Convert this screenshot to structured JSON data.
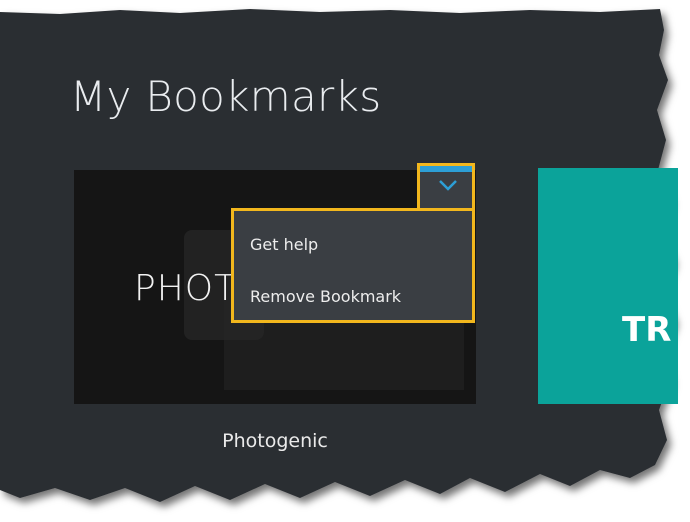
{
  "header": {
    "title": "My Bookmarks"
  },
  "bookmarks": [
    {
      "label": "Photogenic",
      "thumb_text": "PHOT"
    },
    {
      "thumb_text": "TR"
    }
  ],
  "menu": {
    "items": [
      {
        "label": "Get help"
      },
      {
        "label": "Remove Bookmark"
      }
    ]
  },
  "colors": {
    "panel": "#2a2e33",
    "highlight": "#f2b71d",
    "accent": "#2d9fd6",
    "teal": "#0ba39a"
  },
  "icons": {
    "menu_toggle": "chevron-down-icon"
  }
}
